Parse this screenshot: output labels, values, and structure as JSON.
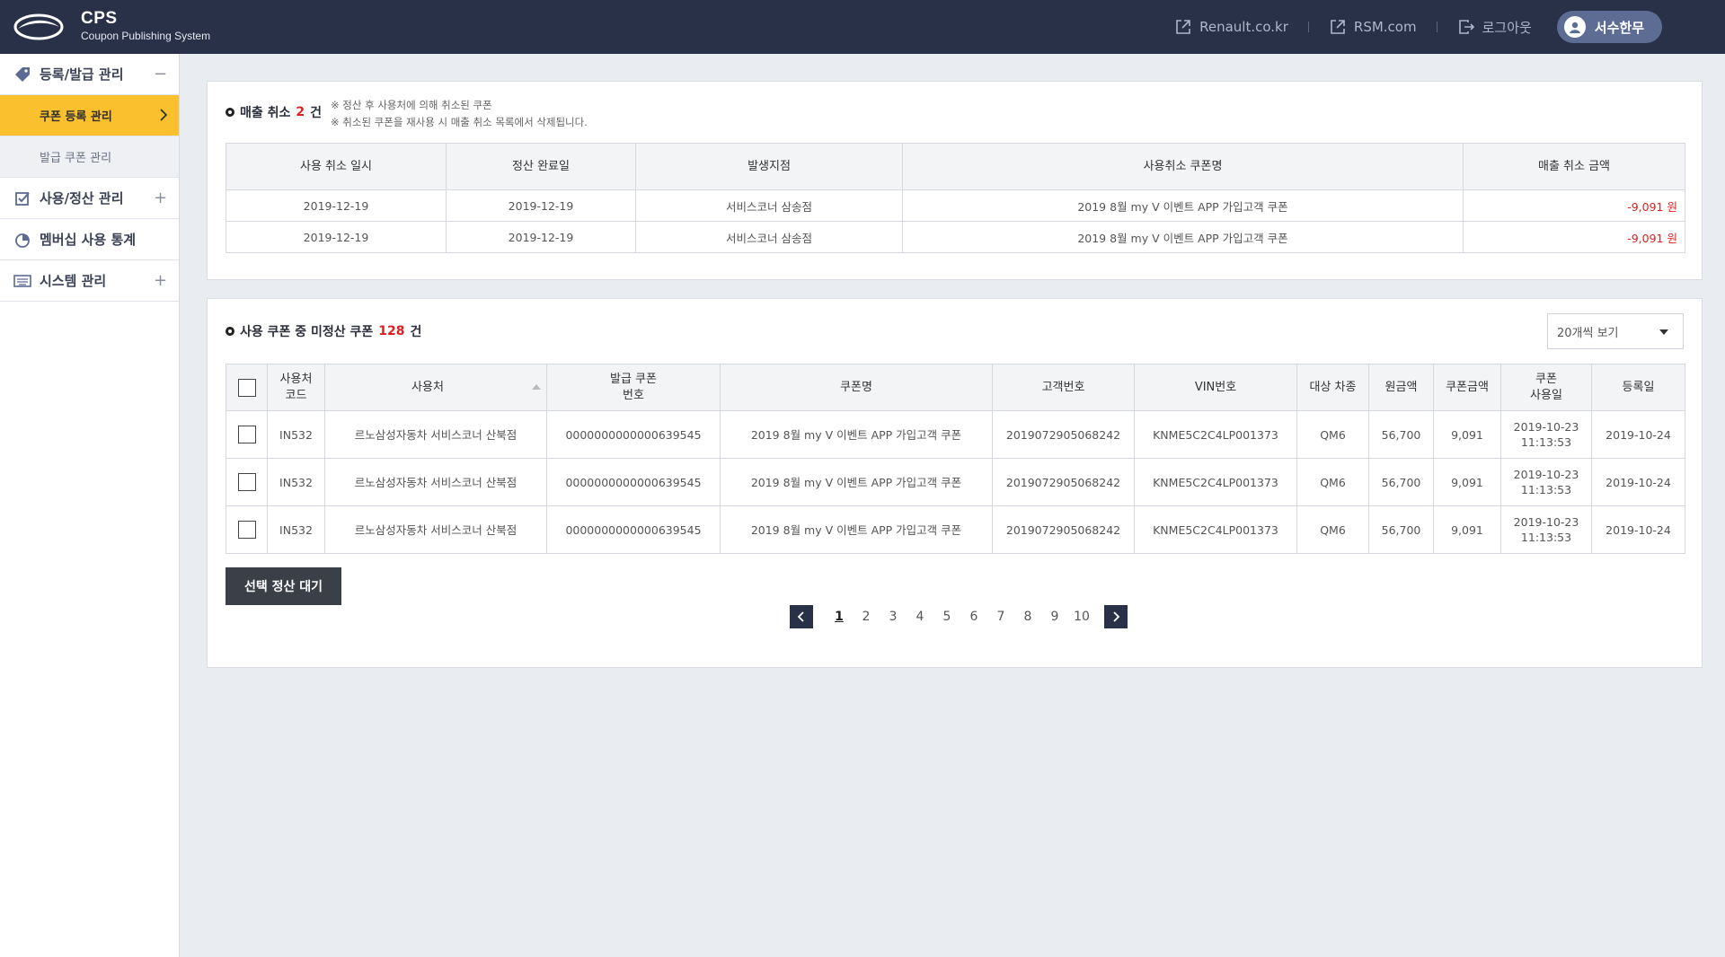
{
  "brand": {
    "title": "CPS",
    "subtitle": "Coupon Publishing System"
  },
  "header": {
    "links": [
      {
        "label": "Renault.co.kr",
        "icon": "external-link-icon"
      },
      {
        "label": "RSM.com",
        "icon": "external-link-icon"
      },
      {
        "label": "로그아웃",
        "icon": "logout-icon"
      }
    ],
    "user": "서수한무"
  },
  "sidebar": {
    "groups": [
      {
        "label": "등록/발급 관리",
        "icon": "tag-icon",
        "toggle": "−",
        "items": [
          {
            "label": "쿠폰 등록 관리",
            "active": true
          },
          {
            "label": "발급 쿠폰 관리",
            "active": false
          }
        ]
      },
      {
        "label": "사용/정산 관리",
        "icon": "checkbox-icon",
        "toggle": "+"
      },
      {
        "label": "멤버십 사용 통계",
        "icon": "pie-chart-icon",
        "toggle": ""
      },
      {
        "label": "시스템 관리",
        "icon": "keyboard-icon",
        "toggle": "+"
      }
    ]
  },
  "cancel_section": {
    "title_prefix": "매출 취소",
    "count": "2",
    "title_suffix": "건",
    "notes": [
      "※ 정산 후 사용처에 의해 취소된 쿠폰",
      "※ 취소된 쿠폰을 재사용 시 매출 취소 목록에서 삭제됩니다."
    ],
    "columns": [
      "사용 취소 일시",
      "정산 완료일",
      "발생지점",
      "사용취소 쿠폰명",
      "매출 취소 금액"
    ],
    "rows": [
      [
        "2019-12-19",
        "2019-12-19",
        "서비스코너 삼송점",
        "2019 8월 my V 이벤트 APP 가입고객 쿠폰",
        "-9,091 원"
      ],
      [
        "2019-12-19",
        "2019-12-19",
        "서비스코너 삼송점",
        "2019 8월 my V 이벤트 APP 가입고객 쿠폰",
        "-9,091 원"
      ]
    ]
  },
  "unsettled_section": {
    "title_prefix": "사용 쿠폰 중 미정산 쿠폰",
    "count": "128",
    "title_suffix": "건",
    "page_size_label": "20개씩 보기",
    "columns": [
      "사용처\n코드",
      "사용처",
      "발급 쿠폰\n번호",
      "쿠폰명",
      "고객번호",
      "VIN번호",
      "대상 차종",
      "원금액",
      "쿠폰금액",
      "쿠폰\n사용일",
      "등록일"
    ],
    "rows": [
      [
        "IN532",
        "르노삼성자동차 서비스코너 산북점",
        "0000000000000639545",
        "2019 8월 my V 이벤트 APP 가입고객 쿠폰",
        "2019072905068242",
        "KNME5C2C4LP001373",
        "QM6",
        "56,700",
        "9,091",
        "2019-10-23\n11:13:53",
        "2019-10-24"
      ],
      [
        "IN532",
        "르노삼성자동차 서비스코너 산북점",
        "0000000000000639545",
        "2019 8월 my V 이벤트 APP 가입고객 쿠폰",
        "2019072905068242",
        "KNME5C2C4LP001373",
        "QM6",
        "56,700",
        "9,091",
        "2019-10-23\n11:13:53",
        "2019-10-24"
      ],
      [
        "IN532",
        "르노삼성자동차 서비스코너 산북점",
        "0000000000000639545",
        "2019 8월 my V 이벤트 APP 가입고객 쿠폰",
        "2019072905068242",
        "KNME5C2C4LP001373",
        "QM6",
        "56,700",
        "9,091",
        "2019-10-23\n11:13:53",
        "2019-10-24"
      ]
    ],
    "action_button": "선택 정산 대기",
    "pagination": {
      "pages": [
        "1",
        "2",
        "3",
        "4",
        "5",
        "6",
        "7",
        "8",
        "9",
        "10"
      ],
      "current": "1"
    }
  },
  "colors": {
    "header_bg": "#283148",
    "active_menu": "#fbc02d",
    "negative": "#e02020",
    "button_dark": "#3b3f48"
  }
}
